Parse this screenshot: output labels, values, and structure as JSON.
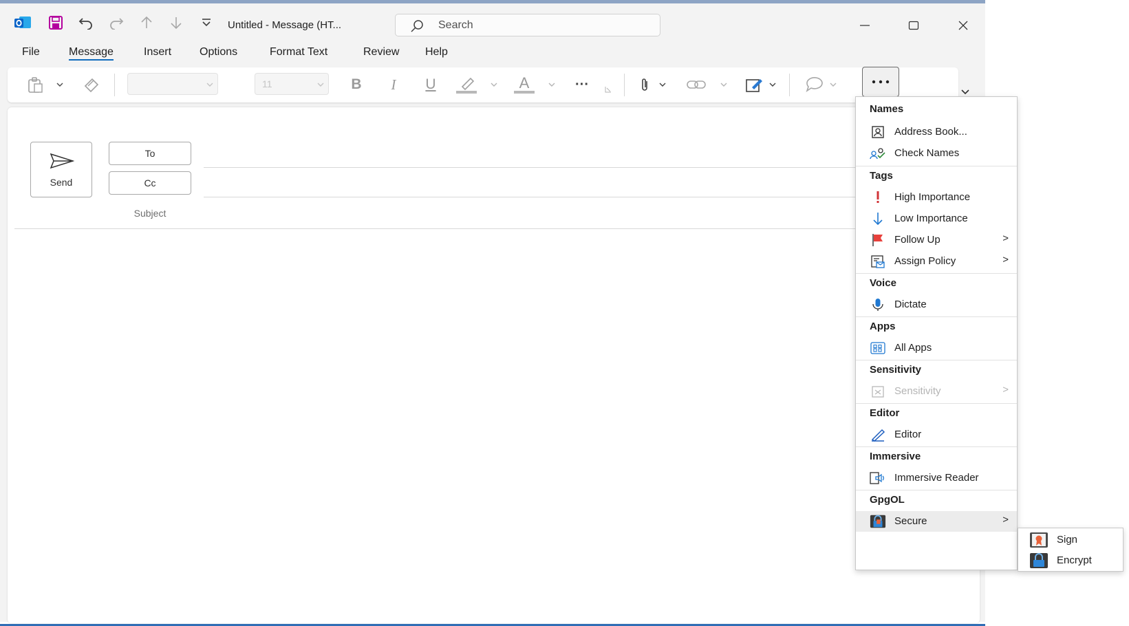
{
  "titlebar": {
    "title": "Untitled  -  Message (HT...",
    "search_placeholder": "Search",
    "icons": [
      "outlook-icon",
      "save-icon",
      "undo-icon",
      "redo-icon",
      "up-arrow-icon",
      "down-arrow-icon",
      "customize-icon"
    ]
  },
  "menu": {
    "tabs": [
      "File",
      "Message",
      "Insert",
      "Options",
      "Format Text",
      "Review",
      "Help"
    ],
    "active": "Message"
  },
  "ribbon": {
    "font_size": "11",
    "bold": "B",
    "italic": "I",
    "underline": "U",
    "font_color": "A",
    "more_label": "···"
  },
  "compose": {
    "send_label": "Send",
    "to_label": "To",
    "cc_label": "Cc",
    "subject_label": "Subject"
  },
  "dropdown": {
    "sections": [
      {
        "header": "Names",
        "items": [
          {
            "label": "Address Book...",
            "icon": "address-book-icon"
          },
          {
            "label": "Check Names",
            "icon": "check-names-icon"
          }
        ]
      },
      {
        "header": "Tags",
        "items": [
          {
            "label": "High Importance",
            "icon": "exclamation-icon"
          },
          {
            "label": "Low Importance",
            "icon": "down-arrow-icon"
          },
          {
            "label": "Follow Up",
            "icon": "flag-icon",
            "submenu": true
          },
          {
            "label": "Assign Policy",
            "icon": "policy-icon",
            "submenu": true
          }
        ]
      },
      {
        "header": "Voice",
        "items": [
          {
            "label": "Dictate",
            "icon": "microphone-icon"
          }
        ]
      },
      {
        "header": "Apps",
        "items": [
          {
            "label": "All Apps",
            "icon": "apps-grid-icon"
          }
        ]
      },
      {
        "header": "Sensitivity",
        "items": [
          {
            "label": "Sensitivity",
            "icon": "sensitivity-icon",
            "submenu": true,
            "disabled": true
          }
        ]
      },
      {
        "header": "Editor",
        "items": [
          {
            "label": "Editor",
            "icon": "editor-pen-icon"
          }
        ]
      },
      {
        "header": "Immersive",
        "items": [
          {
            "label": "Immersive Reader",
            "icon": "immersive-reader-icon"
          }
        ]
      },
      {
        "header": "GpgOL",
        "items": [
          {
            "label": "Secure",
            "icon": "secure-lock-icon",
            "submenu": true
          }
        ]
      }
    ],
    "submenu_arrow": ">"
  },
  "submenu": {
    "items": [
      {
        "label": "Sign",
        "icon": "sign-seal-icon"
      },
      {
        "label": "Encrypt",
        "icon": "encrypt-lock-icon"
      }
    ]
  },
  "colors": {
    "accent": "#0f6cbd",
    "outlook_blue": "#0a64c8",
    "save_purple": "#b4009e",
    "high_importance": "#d13438",
    "low_importance": "#1f78d1"
  }
}
